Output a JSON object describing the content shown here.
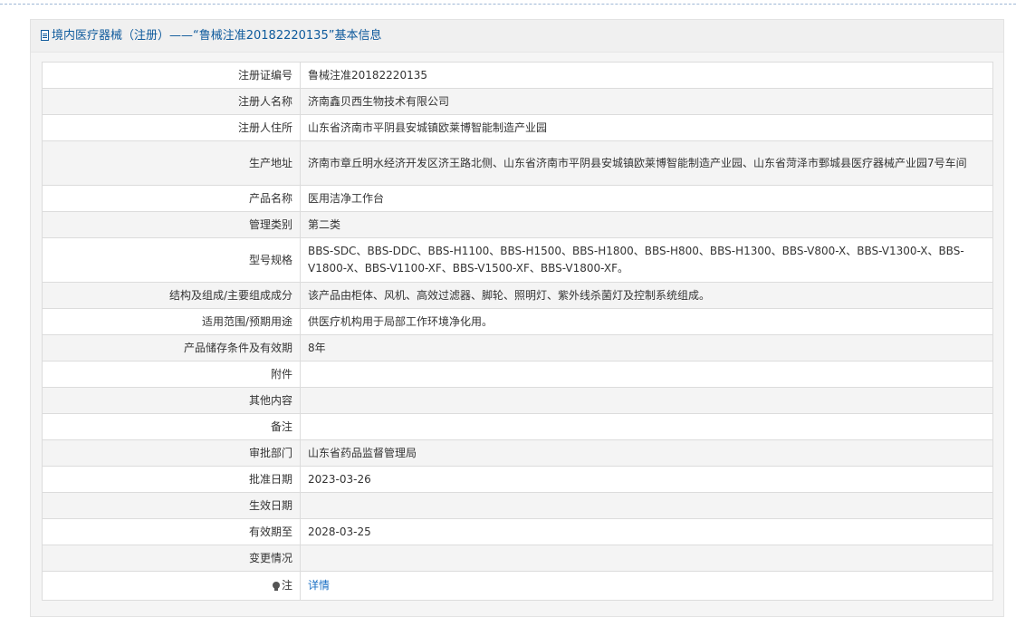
{
  "header": {
    "title": "境内医疗器械（注册）——“鲁械注准20182220135”基本信息"
  },
  "rows": [
    {
      "label": "注册证编号",
      "value": "鲁械注准20182220135"
    },
    {
      "label": "注册人名称",
      "value": "济南鑫贝西生物技术有限公司"
    },
    {
      "label": "注册人住所",
      "value": "山东省济南市平阴县安城镇欧莱博智能制造产业园"
    },
    {
      "label": "生产地址",
      "value": "济南市章丘明水经济开发区济王路北侧、山东省济南市平阴县安城镇欧莱博智能制造产业园、山东省菏泽市鄄城县医疗器械产业园7号车间"
    },
    {
      "label": "产品名称",
      "value": "医用洁净工作台"
    },
    {
      "label": "管理类别",
      "value": "第二类"
    },
    {
      "label": "型号规格",
      "value": "BBS-SDC、BBS-DDC、BBS-H1100、BBS-H1500、BBS-H1800、BBS-H800、BBS-H1300、BBS-V800-X、BBS-V1300-X、BBS-V1800-X、BBS-V1100-XF、BBS-V1500-XF、BBS-V1800-XF。"
    },
    {
      "label": "结构及组成/主要组成成分",
      "value": "该产品由柜体、风机、高效过滤器、脚轮、照明灯、紫外线杀菌灯及控制系统组成。"
    },
    {
      "label": "适用范围/预期用途",
      "value": "供医疗机构用于局部工作环境净化用。"
    },
    {
      "label": "产品储存条件及有效期",
      "value": "8年"
    },
    {
      "label": "附件",
      "value": ""
    },
    {
      "label": "其他内容",
      "value": ""
    },
    {
      "label": "备注",
      "value": ""
    },
    {
      "label": "审批部门",
      "value": "山东省药品监督管理局"
    },
    {
      "label": "批准日期",
      "value": "2023-03-26"
    },
    {
      "label": "生效日期",
      "value": ""
    },
    {
      "label": "有效期至",
      "value": "2028-03-25"
    },
    {
      "label": "变更情况",
      "value": ""
    }
  ],
  "note": {
    "label": "注",
    "link_text": "详情",
    "icon": "lightbulb-icon"
  }
}
